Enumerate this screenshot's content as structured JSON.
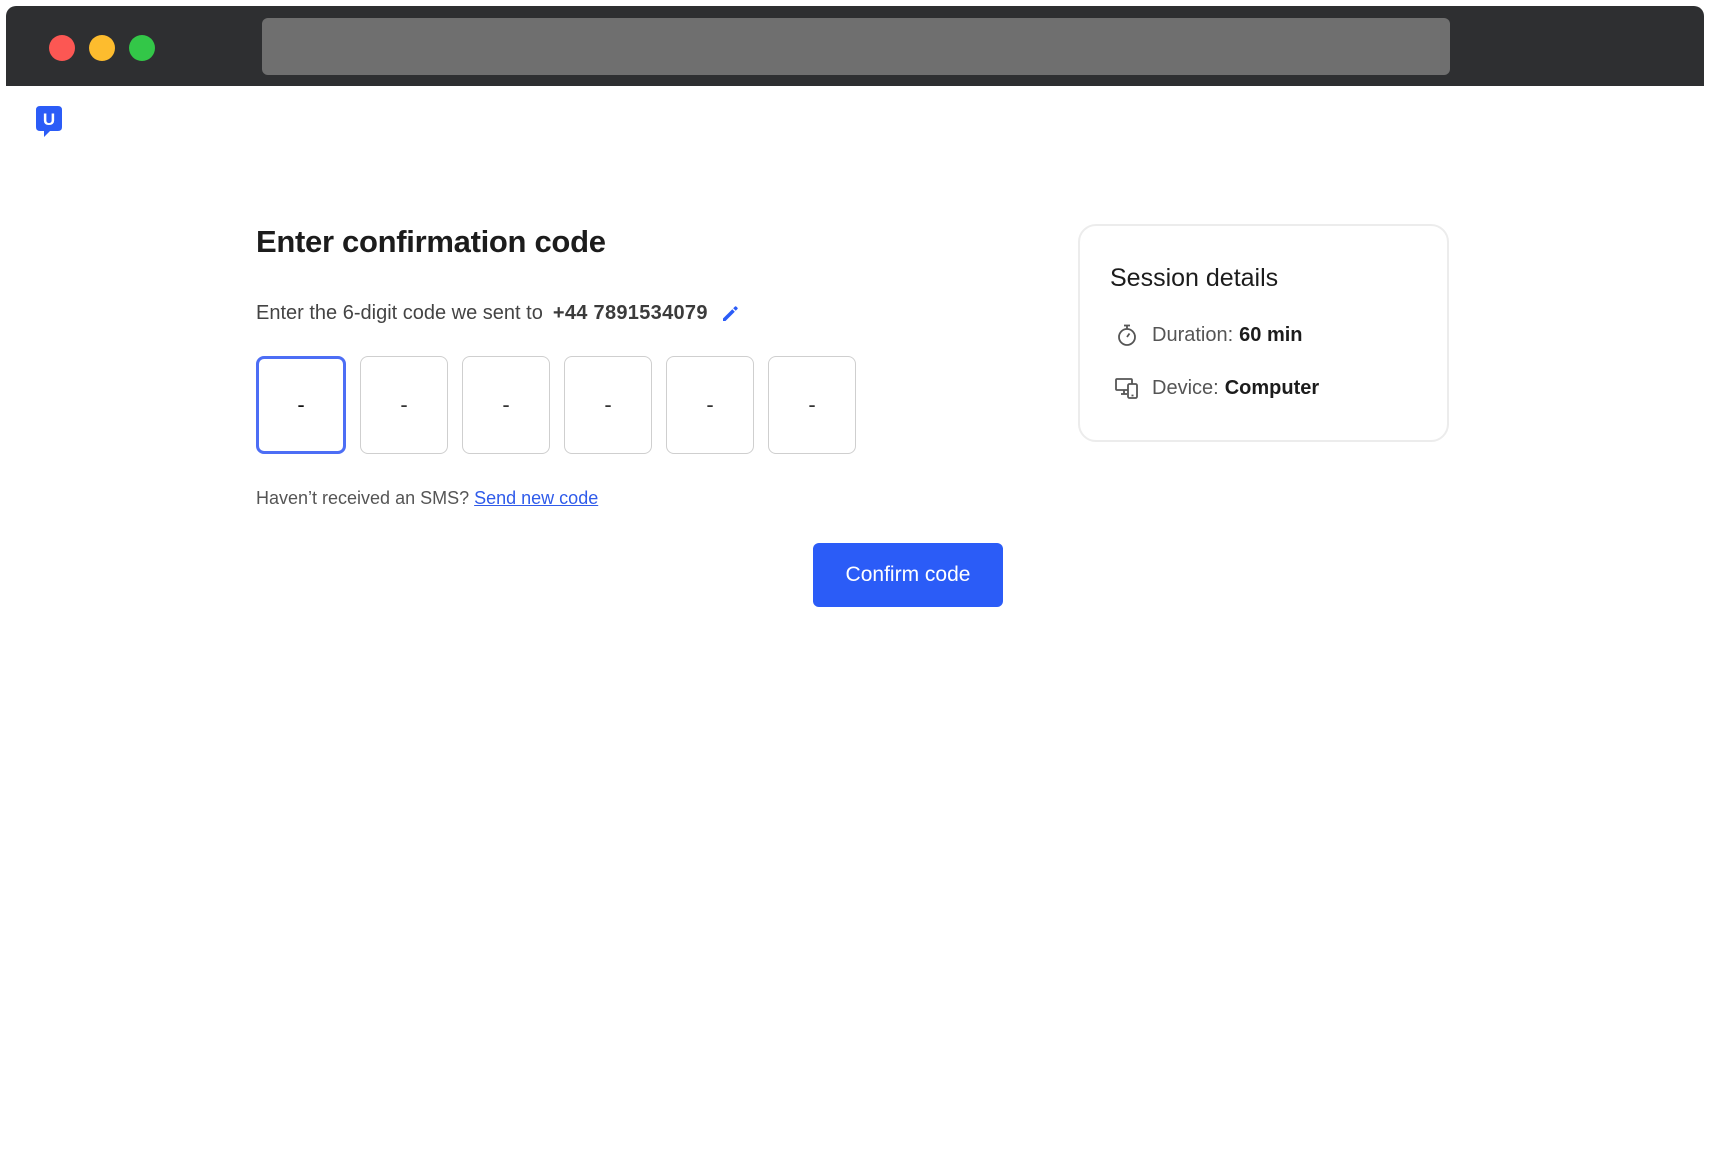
{
  "page": {
    "heading": "Enter confirmation code",
    "subtitle": "Enter the 6-digit code we sent to",
    "phone": "+44 7891534079",
    "code_placeholder": "-",
    "code_digits": [
      "-",
      "-",
      "-",
      "-",
      "-",
      "-"
    ],
    "resend_prompt": "Haven’t received an SMS?",
    "resend_link": "Send new code",
    "confirm_label": "Confirm code"
  },
  "session": {
    "title": "Session details",
    "duration_label": "Duration:",
    "duration_value": "60 min",
    "device_label": "Device:",
    "device_value": "Computer"
  },
  "logo": {
    "letter": "U"
  },
  "icons": {
    "edit": "pencil-icon",
    "duration": "stopwatch-icon",
    "device": "devices-icon"
  },
  "colors": {
    "accent": "#2b5cf7",
    "active_border": "#4d6ef5",
    "link": "#2f5bea"
  }
}
